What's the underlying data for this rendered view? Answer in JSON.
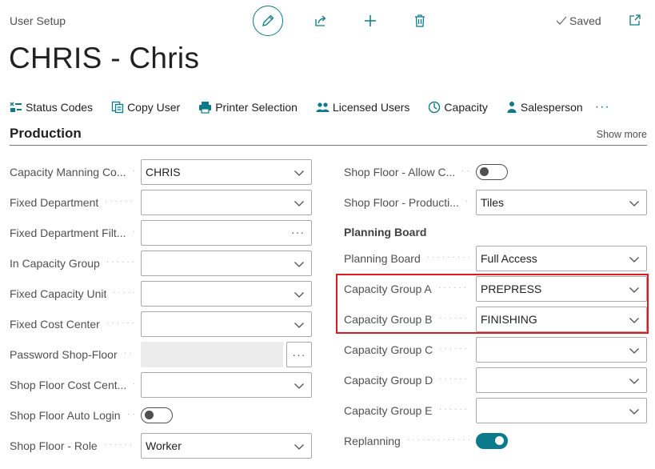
{
  "header": {
    "caption": "User Setup",
    "title": "CHRIS - Chris",
    "status": "Saved"
  },
  "actions": [
    {
      "label": "Status Codes",
      "icon": "status-codes-icon"
    },
    {
      "label": "Copy User",
      "icon": "copy-icon"
    },
    {
      "label": "Printer Selection",
      "icon": "printer-icon"
    },
    {
      "label": "Licensed Users",
      "icon": "users-icon"
    },
    {
      "label": "Capacity",
      "icon": "capacity-icon"
    },
    {
      "label": "Salesperson",
      "icon": "person-icon"
    }
  ],
  "section": {
    "title": "Production",
    "show_more": "Show more"
  },
  "left_fields": [
    {
      "label": "Capacity Manning Co...",
      "value": "CHRIS",
      "type": "select"
    },
    {
      "label": "Fixed Department",
      "value": "",
      "type": "select"
    },
    {
      "label": "Fixed Department Filt...",
      "value": "",
      "type": "lookup"
    },
    {
      "label": "In Capacity Group",
      "value": "",
      "type": "select"
    },
    {
      "label": "Fixed Capacity Unit",
      "value": "",
      "type": "select"
    },
    {
      "label": "Fixed Cost Center",
      "value": "",
      "type": "select"
    },
    {
      "label": "Password Shop-Floor",
      "value": "",
      "type": "password"
    },
    {
      "label": "Shop Floor Cost Cent...",
      "value": "",
      "type": "select"
    },
    {
      "label": "Shop Floor Auto Login",
      "value": false,
      "type": "toggle"
    },
    {
      "label": "Shop Floor - Role",
      "value": "Worker",
      "type": "select"
    }
  ],
  "right_fields": [
    {
      "label": "Shop Floor - Allow C...",
      "value": false,
      "type": "toggle"
    },
    {
      "label": "Shop Floor - Producti...",
      "value": "Tiles",
      "type": "select"
    }
  ],
  "planning_board": {
    "heading": "Planning Board",
    "fields": [
      {
        "label": "Planning Board",
        "value": "Full Access",
        "type": "select"
      },
      {
        "label": "Capacity Group A",
        "value": "PREPRESS",
        "type": "select"
      },
      {
        "label": "Capacity Group B",
        "value": "FINISHING",
        "type": "select"
      },
      {
        "label": "Capacity Group C",
        "value": "",
        "type": "select"
      },
      {
        "label": "Capacity Group D",
        "value": "",
        "type": "select"
      },
      {
        "label": "Capacity Group E",
        "value": "",
        "type": "select"
      },
      {
        "label": "Replanning",
        "value": true,
        "type": "toggle"
      }
    ]
  },
  "colors": {
    "accent": "#0a7a8c",
    "highlight": "#e0191f"
  }
}
